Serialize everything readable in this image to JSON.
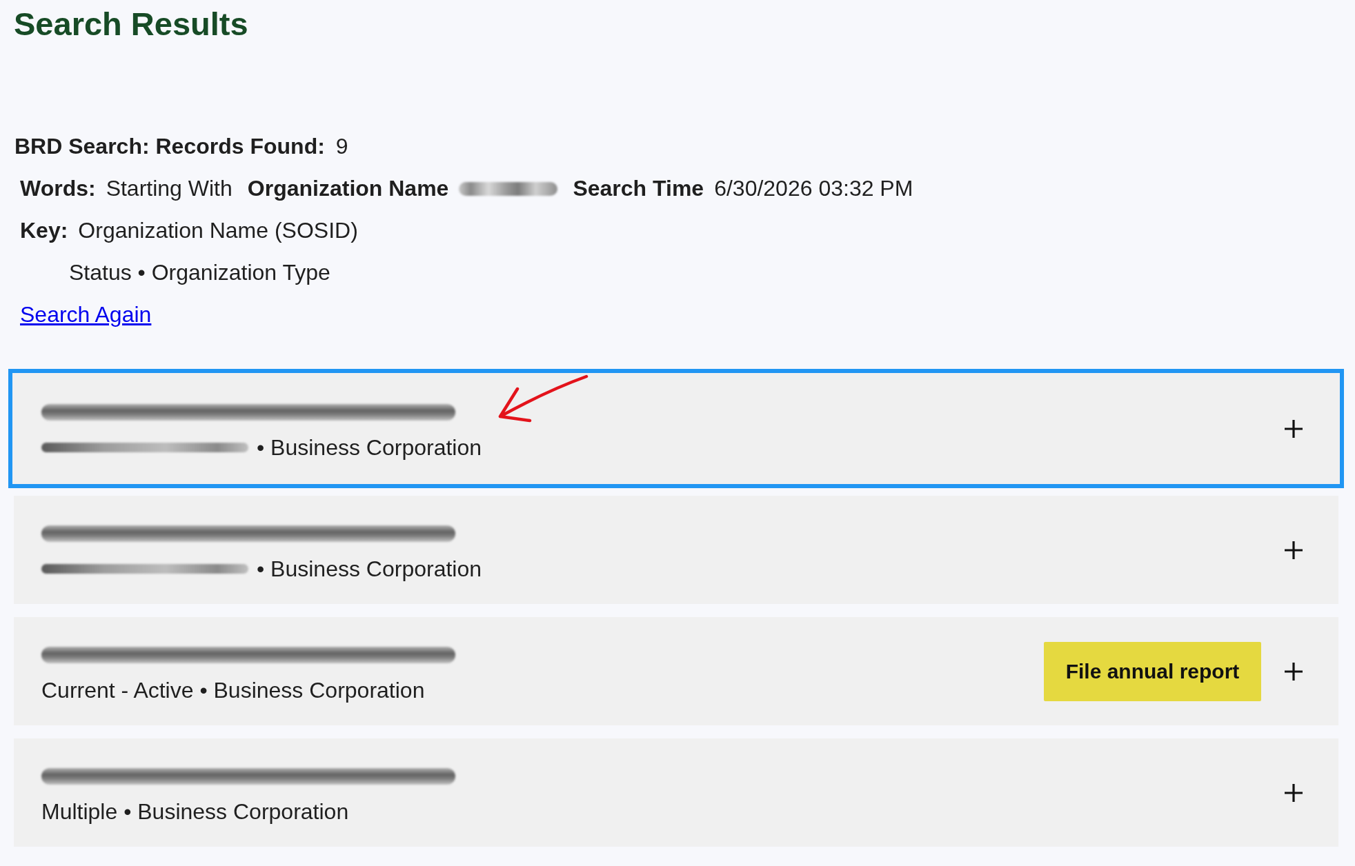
{
  "page_title": "Search Results",
  "summary": {
    "records_found": {
      "label": "BRD Search: Records Found:",
      "value": "9"
    },
    "criteria": [
      {
        "label": "Words:",
        "value": "Starting With",
        "redacted": false
      },
      {
        "label": "Organization Name",
        "redacted": true
      },
      {
        "label": "Search Time",
        "value": "6/30/2026 03:32 PM",
        "redacted": false
      }
    ],
    "key": {
      "label": "Key:",
      "format": "Organization Name (SOSID)",
      "subformat": "Status • Organization Type"
    },
    "search_again_link": "Search Again"
  },
  "results": [
    {
      "name_redacted": true,
      "status_redacted": true,
      "details": "• Business Corporation",
      "focused": true,
      "annotated": true,
      "expanded": false
    },
    {
      "name_redacted": true,
      "status_redacted": true,
      "details": "• Business Corporation",
      "focused": false,
      "annotated": false,
      "expanded": false
    },
    {
      "name_redacted": true,
      "status_redacted": false,
      "details": "Current - Active • Business Corporation",
      "action": "File annual report",
      "focused": false,
      "annotated": false,
      "expanded": false
    },
    {
      "name_redacted": true,
      "status_redacted": false,
      "details": "Multiple • Business Corporation",
      "focused": false,
      "annotated": false,
      "expanded": false
    }
  ]
}
